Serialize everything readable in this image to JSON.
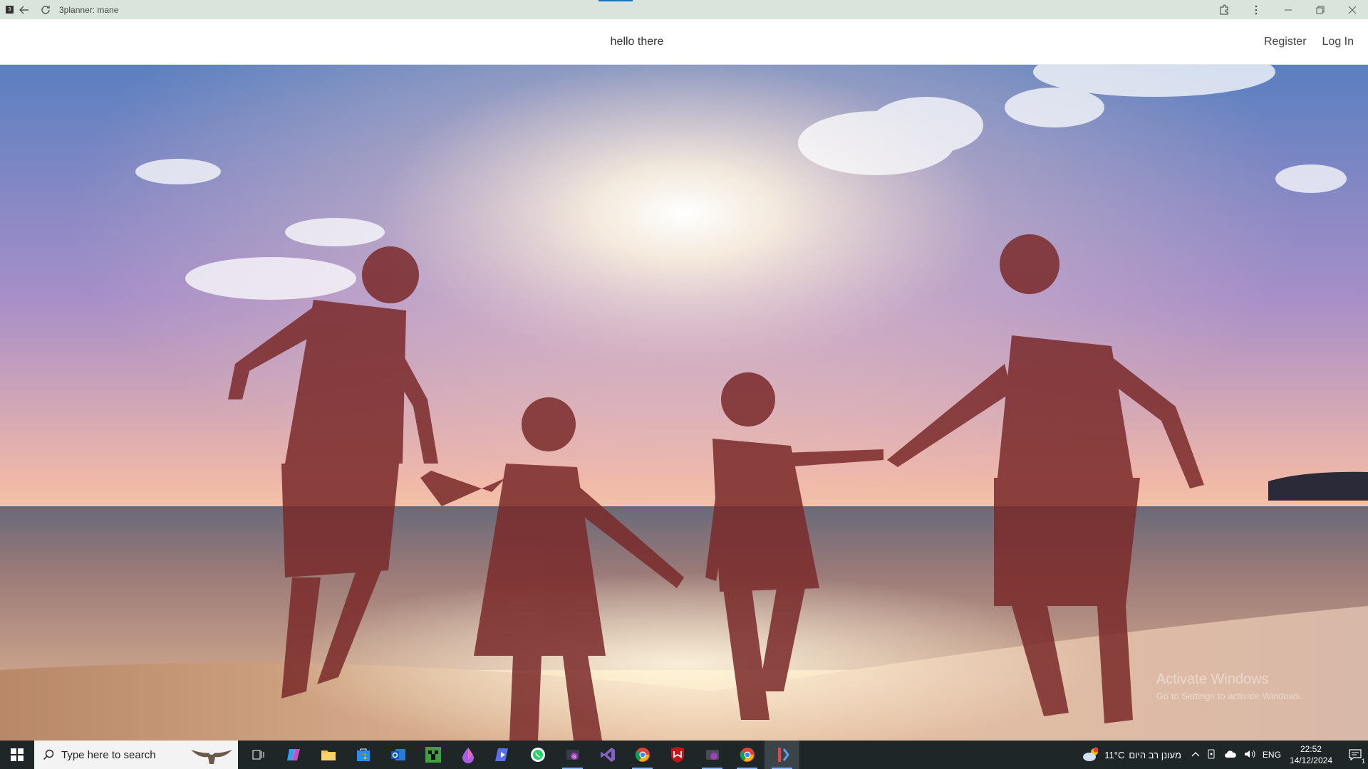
{
  "window": {
    "app_icon": "app-icon",
    "title": "3planner: mane",
    "controls": [
      "back-icon",
      "refresh-icon",
      "extensions-icon",
      "more-icon",
      "minimize-icon",
      "restore-icon",
      "close-icon"
    ]
  },
  "header": {
    "title": "hello there",
    "nav": {
      "register": "Register",
      "login": "Log In"
    }
  },
  "hero": {
    "image": "family-jumping-on-beach-at-sunset",
    "watermark": {
      "title": "Activate Windows",
      "subtitle": "Go to Settings to activate Windows."
    }
  },
  "taskbar": {
    "search_placeholder": "Type here to search",
    "apps": [
      "task-view-icon",
      "copilot-icon",
      "file-explorer-icon",
      "store-icon",
      "outlook-icon",
      "minecraft-icon",
      "paint-drop-icon",
      "media-player-icon",
      "whatsapp-icon",
      "github-desktop-icon",
      "visual-studio-icon",
      "chrome-icon",
      "mcafee-icon",
      "app-g-icon",
      "chrome-profile-icon",
      "active-app-icon"
    ],
    "weather": {
      "temp": "11°C",
      "text": "מעונן רב היום"
    },
    "language": "ENG",
    "time": "22:52",
    "date": "14/12/2024",
    "notifications": "1"
  },
  "colors": {
    "titlebar": "#d9e5dc",
    "taskbar": "#1f2628",
    "accent": "#1e73be"
  }
}
